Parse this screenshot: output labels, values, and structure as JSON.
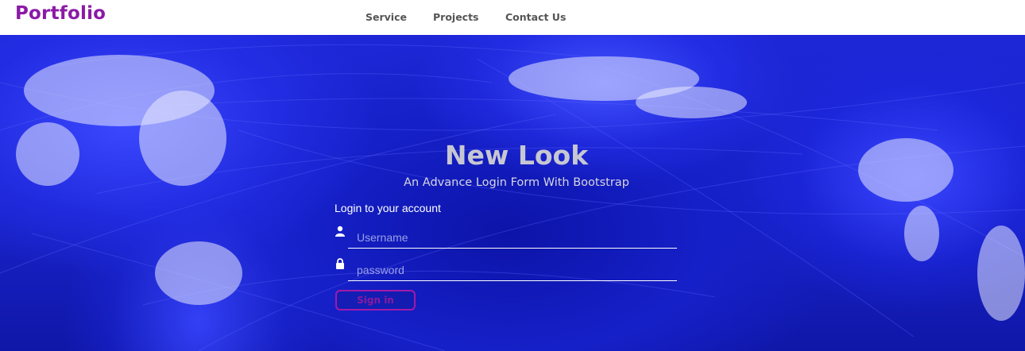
{
  "brand": "Portfolio",
  "nav": {
    "service": "Service",
    "projects": "Projects",
    "contact": "Contact Us"
  },
  "hero": {
    "title": "New Look",
    "subtitle": "An Advance Login Form With Bootstrap"
  },
  "form": {
    "heading": "Login to your account",
    "username_placeholder": "Username",
    "password_placeholder": "password",
    "signin_label": "Sign in"
  },
  "icons": {
    "username": "user-icon",
    "password": "lock-icon"
  },
  "colors": {
    "brand": "#8b1aa6",
    "nav_text": "#555555",
    "hero_blue": "#1d27d6",
    "button_border": "#a21aa8"
  }
}
